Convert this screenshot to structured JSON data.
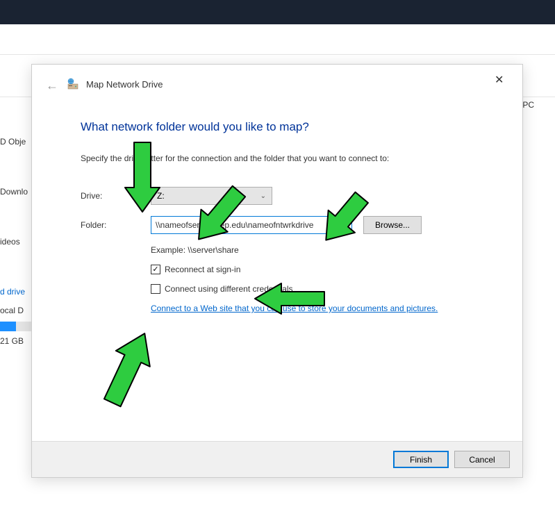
{
  "background": {
    "breadcrumb_suffix": "s PC",
    "sidebar": {
      "item1": "D Obje",
      "item2": "Downlo",
      "item3": "ideos",
      "item4": "d drive",
      "item5": "ocal D",
      "storage": "21 GB"
    }
  },
  "dialog": {
    "title": "Map Network Drive",
    "heading": "What network folder would you like to map?",
    "subtext": "Specify the drive letter for the connection and the folder that you want to connect to:",
    "drive_label": "Drive:",
    "drive_value": "Z:",
    "folder_label": "Folder:",
    "folder_value": "\\\\nameofserver.utep.edu\\nameofntwrkdrive",
    "browse_label": "Browse...",
    "example_text": "Example: \\\\server\\share",
    "reconnect_label": "Reconnect at sign-in",
    "credentials_label": "Connect using different credentials",
    "link_text": "Connect to a Web site that you can use to store your documents and pictures.",
    "finish_label": "Finish",
    "cancel_label": "Cancel"
  }
}
